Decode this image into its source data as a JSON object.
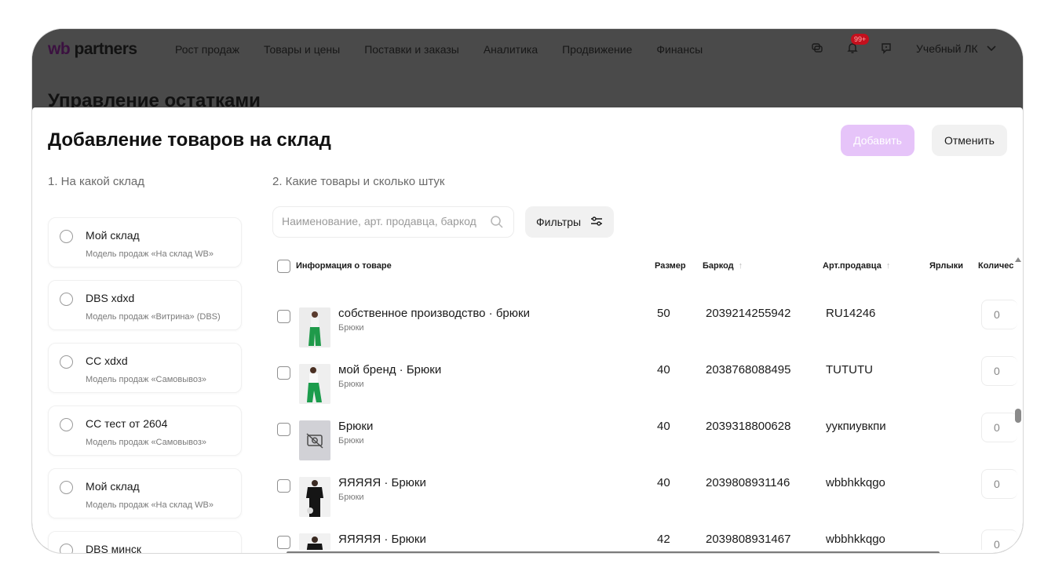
{
  "header": {
    "logo_wb": "wb",
    "logo_partners": "partners",
    "nav": [
      "Рост продаж",
      "Товары и цены",
      "Поставки и заказы",
      "Аналитика",
      "Продвижение",
      "Финансы"
    ],
    "notification_badge": "99+",
    "account": "Учебный ЛК"
  },
  "page": {
    "title": "Управление остатками"
  },
  "modal": {
    "title": "Добавление товаров на склад",
    "add_label": "Добавить",
    "cancel_label": "Отменить",
    "step1": "1. На какой склад",
    "step2": "2. Какие товары и сколько штук",
    "search_placeholder": "Наименование, арт. продавца, баркод",
    "filters_label": "Фильтры"
  },
  "warehouses": [
    {
      "name": "Мой склад",
      "model": "Модель продаж «На склад WB»"
    },
    {
      "name": "DBS xdxd",
      "model": "Модель продаж «Витрина» (DBS)"
    },
    {
      "name": "СС xdxd",
      "model": "Модель продаж «Самовывоз»"
    },
    {
      "name": "СС тест от 2604",
      "model": "Модель продаж «Самовывоз»"
    },
    {
      "name": "Мой склад",
      "model": "Модель продаж «На склад WB»"
    },
    {
      "name": "DBS минск",
      "model": ""
    }
  ],
  "table": {
    "headers": {
      "info": "Информация о товаре",
      "size": "Размер",
      "barcode": "Баркод",
      "article": "Арт.продавца",
      "labels": "Ярлыки",
      "quantity": "Количес"
    },
    "rows": [
      {
        "name": "собственное производство · брюки",
        "sub": "Брюки",
        "size": "50",
        "barcode": "2039214255942",
        "article": "RU14246",
        "qty": "0",
        "thumb": "green"
      },
      {
        "name": "мой бренд · Брюки",
        "sub": "Брюки",
        "size": "40",
        "barcode": "2038768088495",
        "article": "TUTUTU",
        "qty": "0",
        "thumb": "green"
      },
      {
        "name": "Брюки",
        "sub": "Брюки",
        "size": "40",
        "barcode": "2039318800628",
        "article": "уукпиувкпи",
        "qty": "0",
        "thumb": "none"
      },
      {
        "name": "ЯЯЯЯЯ · Брюки",
        "sub": "Брюки",
        "size": "40",
        "barcode": "2039808931146",
        "article": "wbbhkkqgo",
        "qty": "0",
        "thumb": "black"
      },
      {
        "name": "ЯЯЯЯЯ · Брюки",
        "sub": "",
        "size": "42",
        "barcode": "2039808931467",
        "article": "wbbhkkqgo",
        "qty": "0",
        "thumb": "black"
      }
    ]
  },
  "colors": {
    "accent_disabled": "#e6c4f9",
    "overlay": "#4e4e4e",
    "badge": "#c4101d"
  }
}
